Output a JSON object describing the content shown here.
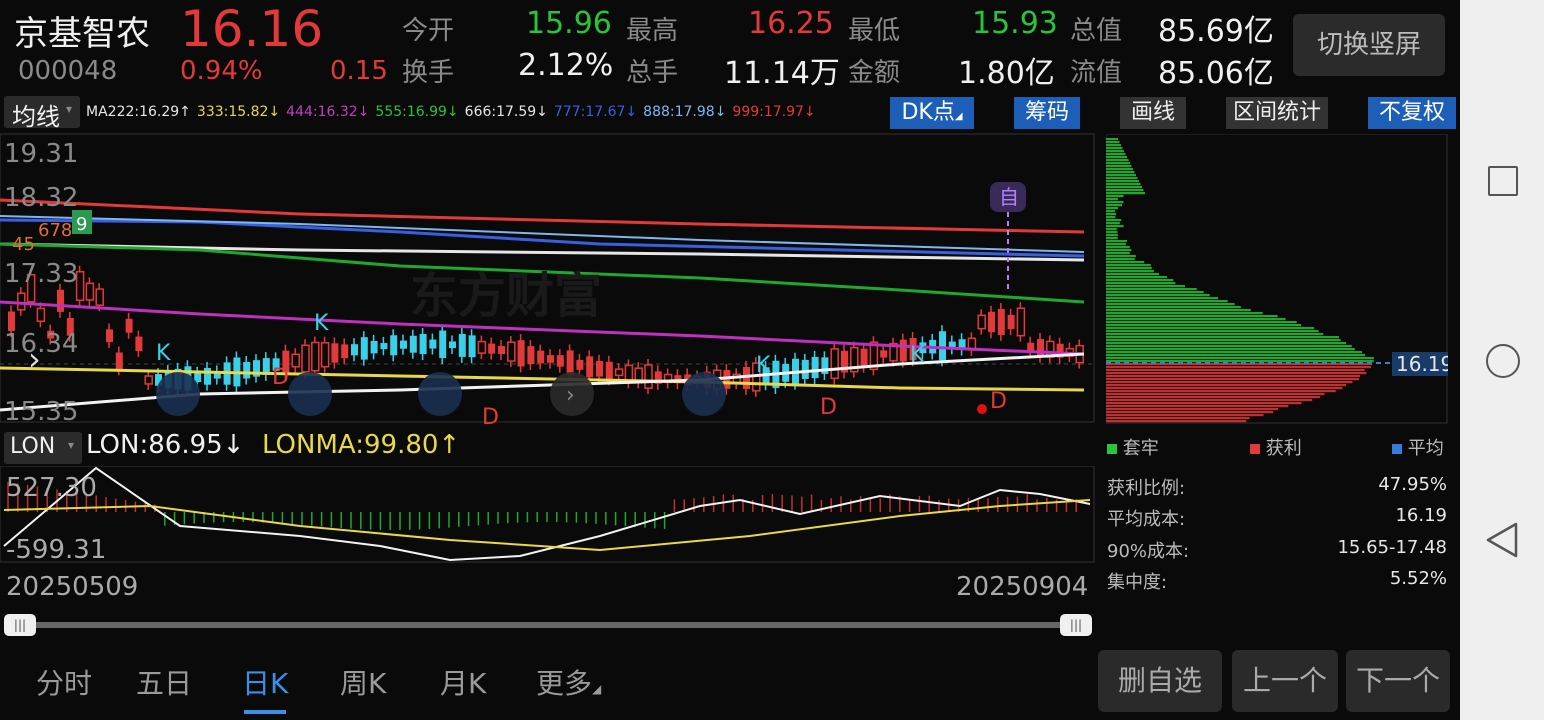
{
  "header": {
    "stock_name": "京基智农",
    "price": "16.16",
    "code": "000048",
    "change_pct": "0.94%",
    "change": "0.15",
    "stats": [
      {
        "label": "今开",
        "value": "15.96"
      },
      {
        "label": "最高",
        "value": "16.25"
      },
      {
        "label": "最低",
        "value": "15.93"
      },
      {
        "label": "总值",
        "value": "85.69亿"
      },
      {
        "label": "换手",
        "value": "2.12%"
      },
      {
        "label": "总手",
        "value": "11.14万"
      },
      {
        "label": "金额",
        "value": "1.80亿"
      },
      {
        "label": "流值",
        "value": "85.06亿"
      }
    ],
    "switch_button": "切换竖屏"
  },
  "ma_bar": {
    "selector": "均线",
    "items": [
      {
        "text": "MA222:16.29↑",
        "color": "#e6e6e6"
      },
      {
        "text": "333:15.82↓",
        "color": "#e8d84a"
      },
      {
        "text": "444:16.32↓",
        "color": "#c040c0"
      },
      {
        "text": "555:16.99↓",
        "color": "#2bc33a"
      },
      {
        "text": "666:17.59↓",
        "color": "#e6e6e6"
      },
      {
        "text": "777:17.67↓",
        "color": "#3a5fe0"
      },
      {
        "text": "888:17.98↓",
        "color": "#7fb6f0"
      },
      {
        "text": "999:17.97↓",
        "color": "#e23a3a"
      }
    ],
    "dk_button": "DK点",
    "chip_button": "筹码",
    "draw_button": "画线",
    "range_button": "区间统计",
    "adjust_button": "不复权"
  },
  "chart": {
    "y_labels": [
      "19.31",
      "18.32",
      "17.33",
      "16.34",
      "15.35"
    ],
    "markers": {
      "self": "自",
      "k": "K",
      "d": "D",
      "nine": "9",
      "nums": "45",
      "nums2": "678"
    },
    "watermark": "东方财富"
  },
  "chip": {
    "price_tag": "16.19",
    "legend": [
      {
        "label": "套牢",
        "color": "#2bc33a"
      },
      {
        "label": "获利",
        "color": "#e23a3a"
      },
      {
        "label": "平均",
        "color": "#3a7be0"
      }
    ],
    "rows": [
      {
        "label": "获利比例:",
        "value": "47.95%"
      },
      {
        "label": "平均成本:",
        "value": "16.19"
      },
      {
        "label": "90%成本:",
        "value": "15.65-17.48"
      },
      {
        "label": "集中度:",
        "value": "5.52%"
      }
    ]
  },
  "indicator": {
    "selector": "LON",
    "lon": "LON:86.95↓",
    "lonma": "LONMA:99.80↑",
    "y_top": "527.30",
    "y_bottom": "-599.31",
    "date_start": "20250509",
    "date_end": "20250904"
  },
  "tabs": [
    "分时",
    "五日",
    "日K",
    "周K",
    "月K",
    "更多"
  ],
  "active_tab": "日K",
  "bottom_buttons": [
    "删自选",
    "上一个",
    "下一个"
  ]
}
